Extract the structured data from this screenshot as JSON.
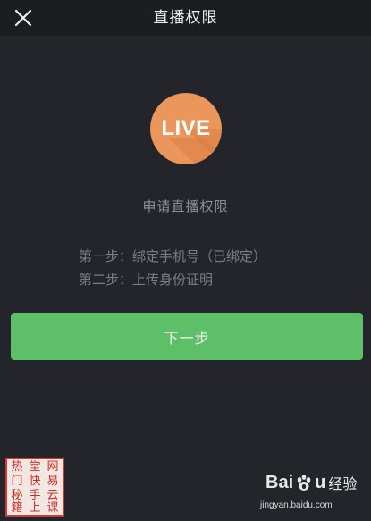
{
  "header": {
    "title": "直播权限",
    "close_icon": "close-icon"
  },
  "logo": {
    "text": "LIVE",
    "color": "#eb965a"
  },
  "apply": {
    "title": "申请直播权限"
  },
  "steps": [
    "第一步：绑定手机号（已绑定）",
    "第二步：上传身份证明"
  ],
  "next_button": {
    "label": "下一步",
    "color": "#5dbf67"
  },
  "stamp": {
    "chars": [
      "热",
      "堂",
      "网",
      "门",
      "快",
      "易",
      "秘",
      "手",
      "云",
      "籍",
      "上",
      "课"
    ]
  },
  "watermark": {
    "logo_prefix": "Bai",
    "logo_suffix": "u",
    "logo_cn": "经验",
    "url": "jingyan.baidu.com"
  },
  "colors": {
    "background": "#23252b",
    "topbar": "#1c1d21"
  }
}
